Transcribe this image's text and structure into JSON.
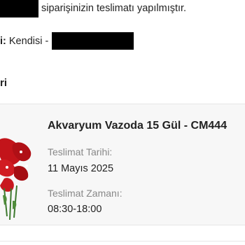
{
  "message": {
    "status_text": "siparişinizin teslimatı yapılmıştır.",
    "receiver_label": "i:",
    "receiver_value": "Kendisi -"
  },
  "section_title": "ri",
  "order_item": {
    "title": "Akvaryum Vazoda 15 Gül - CM444",
    "delivery_date_label": "Teslimat Tarihi:",
    "delivery_date": "11 Mayıs 2025",
    "delivery_time_label": "Teslimat Zamanı:",
    "delivery_time": "08:30-18:00"
  }
}
